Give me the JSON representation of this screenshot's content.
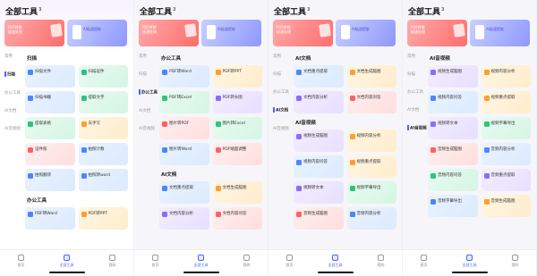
{
  "app": {
    "title": "全部工具",
    "title_superscript": "3"
  },
  "promos": [
    {
      "text": "PDF转换\n极速处理"
    },
    {
      "text": "AI极速提取"
    }
  ],
  "sidebar": [
    "常用",
    "扫描",
    "办公工具",
    "AI文档",
    "AI音视频"
  ],
  "tabbar": [
    "首页",
    "全部工具",
    "我的"
  ],
  "phones": [
    {
      "active_sidebar": 1,
      "sections": [
        {
          "title": "扫描",
          "items": [
            {
              "label": "扫描文件",
              "tint": 0
            },
            {
              "label": "扫描证件",
              "tint": 3
            },
            {
              "label": "扫描书籍",
              "tint": 0
            },
            {
              "label": "提取文字",
              "tint": 3
            },
            {
              "label": "提取表格",
              "tint": 3
            },
            {
              "label": "去手写",
              "tint": 1
            },
            {
              "label": "证件照",
              "tint": 4
            },
            {
              "label": "拍照计数",
              "tint": 0
            },
            {
              "label": "拍照翻译",
              "tint": 0
            },
            {
              "label": "拍照转word",
              "tint": 0
            }
          ]
        },
        {
          "title": "办公工具",
          "items": [
            {
              "label": "PDF转Word",
              "tint": 0
            },
            {
              "label": "PDF转PPT",
              "tint": 1
            }
          ]
        }
      ]
    },
    {
      "active_sidebar": 2,
      "sections": [
        {
          "title": "办公工具",
          "items": [
            {
              "label": "PDF转Word",
              "tint": 0
            },
            {
              "label": "PDF转PPT",
              "tint": 1
            },
            {
              "label": "PDF转Excel",
              "tint": 3
            },
            {
              "label": "PDF转长图",
              "tint": 2
            },
            {
              "label": "图片转PDF",
              "tint": 4
            },
            {
              "label": "图片转Excel",
              "tint": 3
            },
            {
              "label": "图片转Word",
              "tint": 0
            },
            {
              "label": "PDF缩面调整",
              "tint": 4
            }
          ]
        },
        {
          "title": "AI文档",
          "items": [
            {
              "label": "文档重点提取",
              "tint": 0
            },
            {
              "label": "文档生成脑图",
              "tint": 1
            },
            {
              "label": "文档内容分析",
              "tint": 2
            },
            {
              "label": "文档内容问答",
              "tint": 4
            }
          ]
        }
      ]
    },
    {
      "active_sidebar": 3,
      "sections": [
        {
          "title": "AI文档",
          "items": [
            {
              "label": "文档重点提取",
              "tint": 0
            },
            {
              "label": "文档生成脑图",
              "tint": 1
            },
            {
              "label": "文档内容分析",
              "tint": 2
            },
            {
              "label": "文档内容问答",
              "tint": 4
            }
          ]
        },
        {
          "title": "AI音视频",
          "items": [
            {
              "label": "视频生成脑图",
              "tint": 2
            },
            {
              "label": "视频内容分析",
              "tint": 1
            },
            {
              "label": "视频内容问答",
              "tint": 0
            },
            {
              "label": "视频重点提取",
              "tint": 1
            },
            {
              "label": "视频转文本",
              "tint": 2
            },
            {
              "label": "视频字幕导出",
              "tint": 3
            },
            {
              "label": "音频生成脑图",
              "tint": 4
            },
            {
              "label": "音频内容分析",
              "tint": 0
            }
          ]
        }
      ]
    },
    {
      "active_sidebar": 4,
      "sections": [
        {
          "title": "AI音视频",
          "items": [
            {
              "label": "视频生成脑图",
              "tint": 2
            },
            {
              "label": "视频内容分析",
              "tint": 1
            },
            {
              "label": "视频内容问答",
              "tint": 0
            },
            {
              "label": "视频重点提取",
              "tint": 1
            },
            {
              "label": "视频转文本",
              "tint": 2
            },
            {
              "label": "视频字幕导出",
              "tint": 3
            },
            {
              "label": "音频生成脑图",
              "tint": 4
            },
            {
              "label": "音频内容分析",
              "tint": 0
            },
            {
              "label": "音频内容问答",
              "tint": 3
            },
            {
              "label": "音频重点提取",
              "tint": 2
            },
            {
              "label": "音频字幕导出",
              "tint": 0
            },
            {
              "label": "音频生成脑图",
              "tint": 1
            }
          ]
        }
      ]
    }
  ]
}
